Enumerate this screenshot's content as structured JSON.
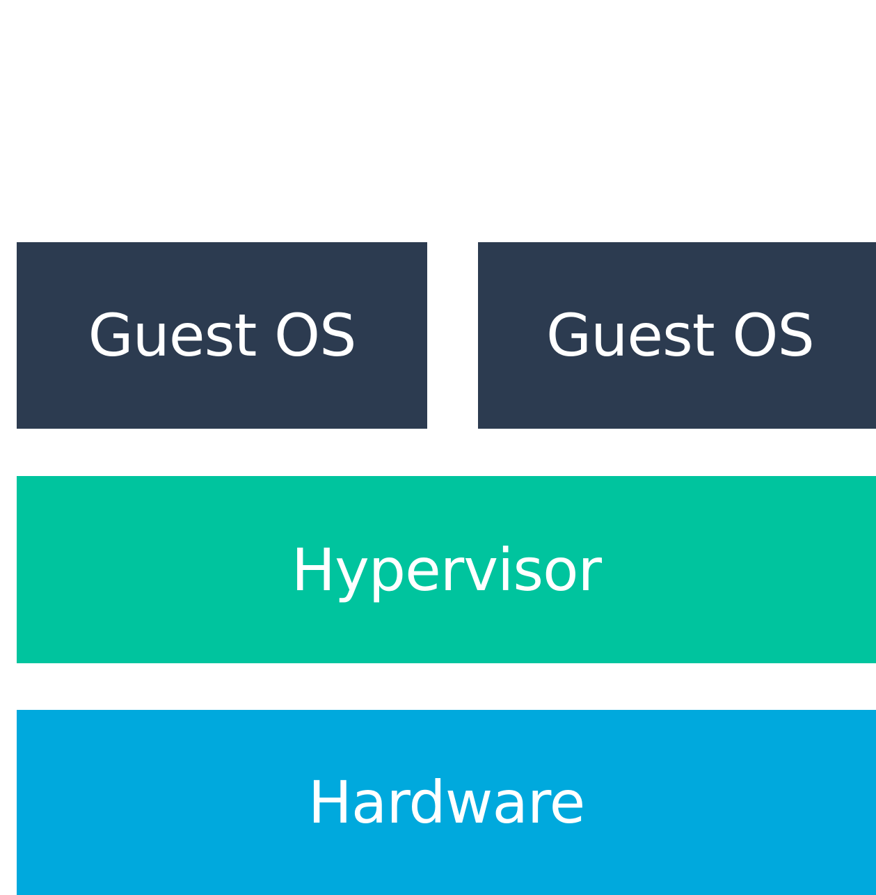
{
  "diagram": {
    "layers": [
      {
        "id": "guest_os_1",
        "label": "Guest OS",
        "color": "#2c3b50"
      },
      {
        "id": "guest_os_2",
        "label": "Guest OS",
        "color": "#2c3b50"
      },
      {
        "id": "hypervisor",
        "label": "Hypervisor",
        "color": "#00c49e"
      },
      {
        "id": "hardware",
        "label": "Hardware",
        "color": "#00a9dd"
      }
    ]
  }
}
